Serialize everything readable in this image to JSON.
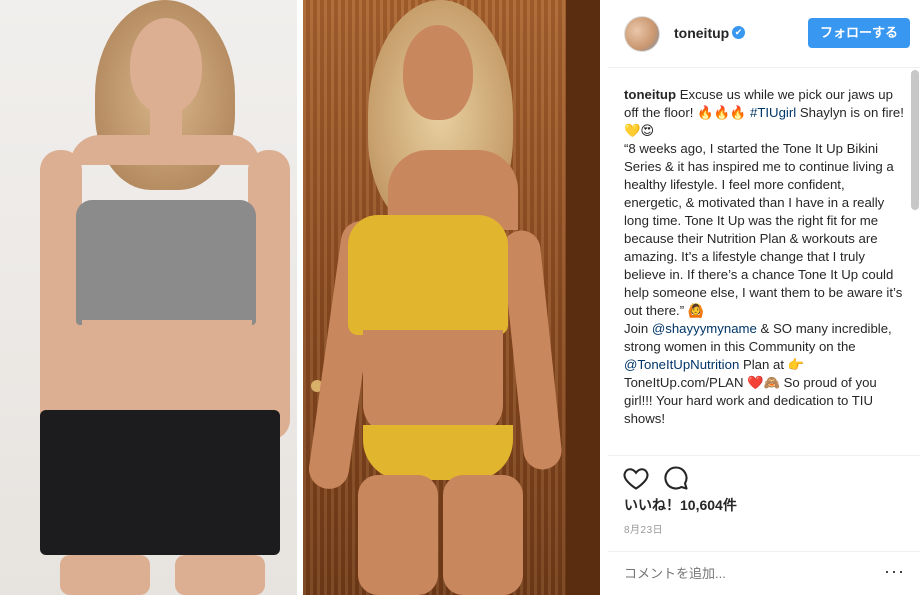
{
  "post": {
    "photo_alt": "Before and after photos"
  },
  "header": {
    "username": "toneitup",
    "verified_icon": "✔",
    "follow_label": "フォローする"
  },
  "caption": {
    "author": "toneitup",
    "line1": "Excuse us while we pick our jaws up off the floor! 🔥🔥🔥",
    "hashtag": "#TIUgirl",
    "line1b": " Shaylyn is on fire! 💛😍",
    "quote": "“8 weeks ago, I started the Tone It Up Bikini Series & it has inspired me to continue living a healthy lifestyle. I feel more confident, energetic, & motivated than I have in a really long time. Tone It Up was the right fit for me because their Nutrition Plan & workouts are amazing. It’s a lifestyle change that I truly believe in. If there’s a chance Tone It Up could help someone else, I want them to be aware it’s out there.” 🙆",
    "join_prefix": "Join ",
    "mention1": "@shayyymyname",
    "join_mid": " & SO many incredible, strong women in this Community on the ",
    "mention2": "@ToneItUpNutrition",
    "join_end": " Plan at 👉 ToneItUp.com/PLAN ❤️🙈 So proud of you girl!!! Your hard work and dedication to TIU shows!"
  },
  "actions": {
    "likes": "いいね！10,604件",
    "date": "8月23日"
  },
  "comment": {
    "placeholder": "コメントを追加...",
    "more": "···"
  },
  "colors": {
    "accent": "#3897f0",
    "link": "#003569"
  }
}
